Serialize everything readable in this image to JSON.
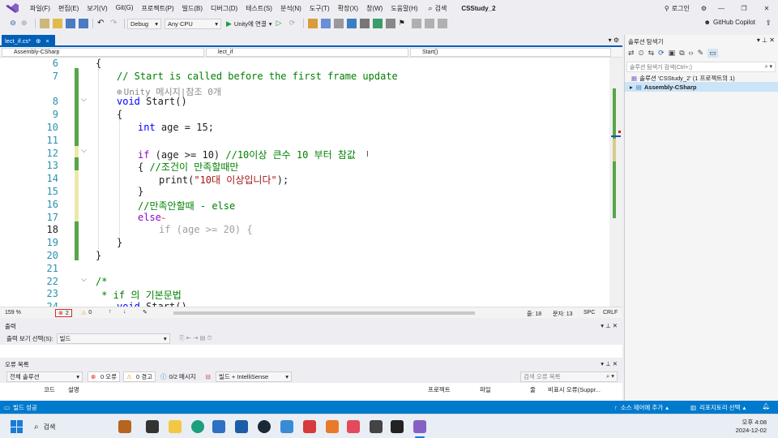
{
  "menu": {
    "items": [
      "파일(F)",
      "편집(E)",
      "보기(V)",
      "Git(G)",
      "프로젝트(P)",
      "빌드(B)",
      "디버그(D)",
      "테스트(S)",
      "분석(N)",
      "도구(T)",
      "확장(X)",
      "창(W)",
      "도움말(H)"
    ],
    "search_label": "검색",
    "solution_title": "CSStudy_2",
    "login": "로그인",
    "copilot": "GitHub Copilot"
  },
  "toolbar": {
    "config": "Debug",
    "platform": "Any CPU",
    "run_label": "Unity에 연결"
  },
  "doc_tab": {
    "label": "lect_if.cs*",
    "pin": "⊕",
    "close": "×"
  },
  "navbar": {
    "project": "Assembly-CSharp",
    "class": "lect_if",
    "member": "Start()"
  },
  "editor": {
    "lines": [
      {
        "n": "6",
        "code": "{"
      },
      {
        "n": "7",
        "code": "// Start is called before the first frame update"
      },
      {
        "n": "",
        "code": "Unity 메시지|참조 0개"
      },
      {
        "n": "8",
        "code": "void Start()"
      },
      {
        "n": "9",
        "code": "{"
      },
      {
        "n": "10",
        "code": "int age = 15;"
      },
      {
        "n": "11",
        "code": ""
      },
      {
        "n": "12",
        "code": "if (age >= 10) //10이상 큰수 10 부터 참값"
      },
      {
        "n": "13",
        "code": "{ //조건이 만족할때만"
      },
      {
        "n": "14",
        "code": "print(\"10대 이상입니다\");"
      },
      {
        "n": "15",
        "code": "}"
      },
      {
        "n": "16",
        "code": "//만족안할때 - else"
      },
      {
        "n": "17",
        "code": "else"
      },
      {
        "n": "18",
        "code": "if (age >= 20) {"
      },
      {
        "n": "19",
        "code": "}"
      },
      {
        "n": "20",
        "code": "}"
      },
      {
        "n": "21",
        "code": ""
      },
      {
        "n": "22",
        "code": "/*"
      },
      {
        "n": "23",
        "code": " * if 의 기본문법"
      },
      {
        "n": "24",
        "code": "void Start()"
      }
    ]
  },
  "editor_status": {
    "zoom": "159 %",
    "errors": "2",
    "warnings": "0",
    "line": "줄: 18",
    "char": "문자: 13",
    "spc": "SPC",
    "crlf": "CRLF"
  },
  "output": {
    "title": "출력",
    "show_label": "출력 보기 선택(S):",
    "source": "빌드"
  },
  "errorlist": {
    "title": "오류 목록",
    "scope": "전체 솔루션",
    "errors": "0 오류",
    "warnings": "0 경고",
    "messages": "0/2 메시지",
    "filter": "빌드 + IntelliSense",
    "search_placeholder": "검색 오류 목록",
    "columns": [
      "코드",
      "설명",
      "프로젝트",
      "파일",
      "줄",
      "비표시 오류(Suppr..."
    ]
  },
  "solution_explorer": {
    "title": "솔루션 탐색기",
    "search_placeholder": "솔루션 탐색기 검색(Ctrl+;)",
    "solution_node": "솔루션 'CSStudy_2' (1 프로젝트의 1)",
    "project_node": "Assembly-CSharp"
  },
  "statusbar": {
    "build": "빌드 성공",
    "source_control": "소스 제어에 추가",
    "repo": "리포지토리 선택"
  },
  "taskbar": {
    "search": "검색",
    "time": "오후 4:08",
    "date": "2024-12-02"
  }
}
